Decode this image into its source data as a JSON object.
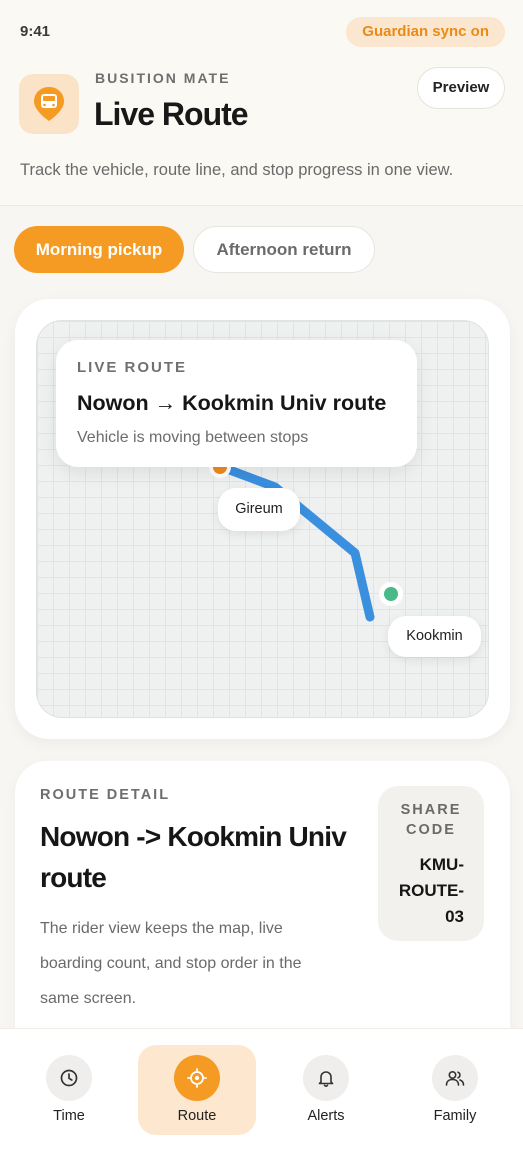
{
  "status_bar": {
    "time": "9:41",
    "sync_badge": "Guardian sync on"
  },
  "header": {
    "brand": "BUSITION MATE",
    "title": "Live Route",
    "preview_label": "Preview",
    "subtitle": "Track the vehicle, route line, and stop progress in one view."
  },
  "segments": [
    {
      "label": "Morning pickup",
      "active": true
    },
    {
      "label": "Afternoon return",
      "active": false
    }
  ],
  "map": {
    "live_card": {
      "eyebrow": "LIVE ROUTE",
      "title": "Nowon → Kookmin Univ route",
      "status": "Vehicle is moving between stops"
    },
    "stops": [
      {
        "label": "Gireum"
      },
      {
        "label": "Kookmin"
      }
    ],
    "colors": {
      "route": "#3a8fde",
      "vehicle": "#f08a1c",
      "destination": "#4ab98a"
    }
  },
  "detail": {
    "eyebrow": "ROUTE DETAIL",
    "title": "Nowon -> Kookmin Univ route",
    "description": "The rider view keeps the map, live boarding count, and stop order in the same screen.",
    "share_label": "SHARE CODE",
    "share_code": "KMU-ROUTE-03"
  },
  "nav": {
    "items": [
      {
        "label": "Time",
        "icon": "clock-icon",
        "active": false
      },
      {
        "label": "Route",
        "icon": "target-icon",
        "active": true
      },
      {
        "label": "Alerts",
        "icon": "bell-icon",
        "active": false
      },
      {
        "label": "Family",
        "icon": "people-icon",
        "active": false
      }
    ]
  },
  "colors": {
    "accent": "#f59a22",
    "accent_soft": "#fde7ce",
    "background": "#f7f6f3"
  }
}
